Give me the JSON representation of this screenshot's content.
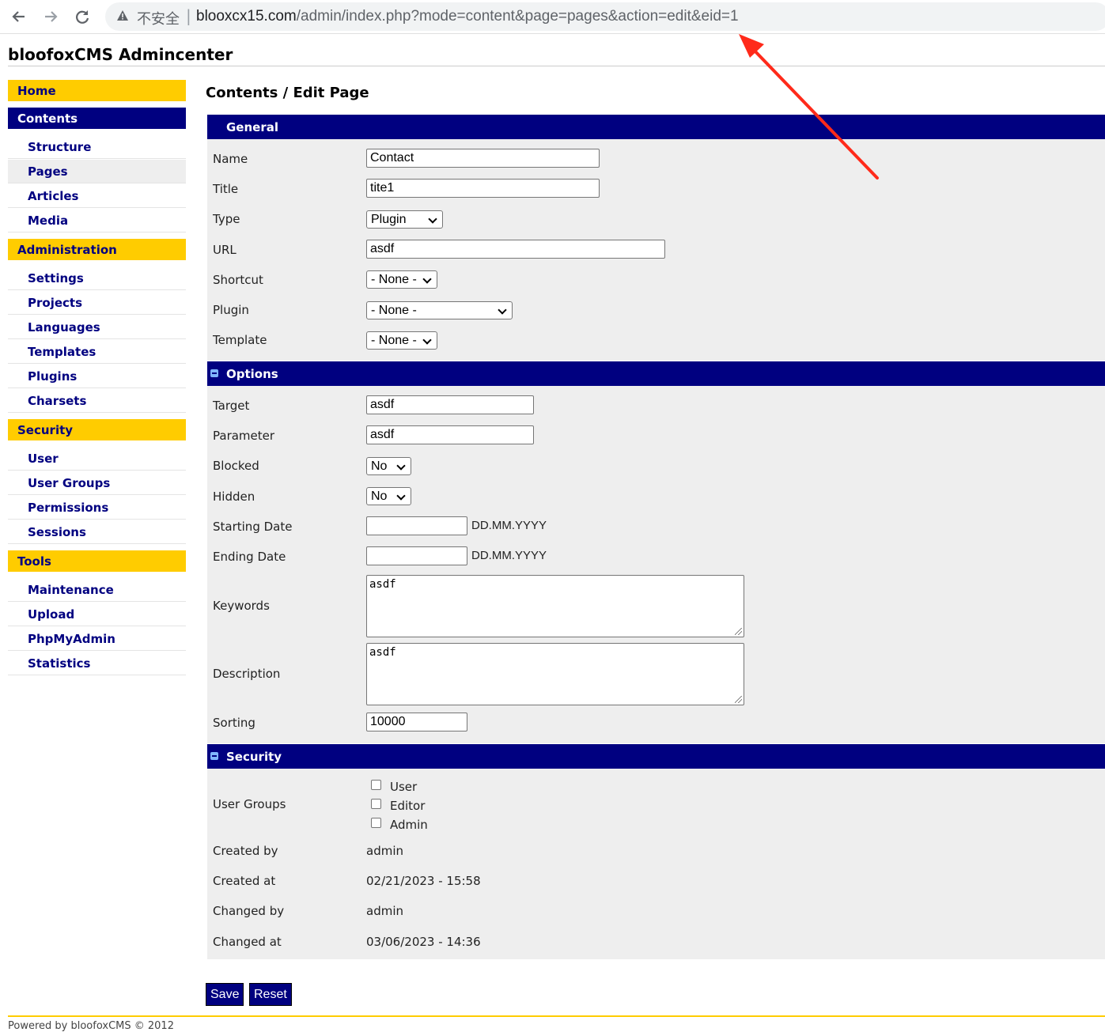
{
  "browser": {
    "back_icon": "back-arrow-icon",
    "forward_icon": "forward-arrow-icon",
    "reload_icon": "reload-icon",
    "security_label": "不安全",
    "separator": "|",
    "url_host": "blooxcx15.com",
    "url_path": "/admin/index.php?mode=content&page=pages&action=edit&eid=1"
  },
  "header": {
    "title": "bloofoxCMS Admincenter"
  },
  "sidebar": {
    "home": "Home",
    "contents": "Contents",
    "contents_items": [
      "Structure",
      "Pages",
      "Articles",
      "Media"
    ],
    "administration": "Administration",
    "administration_items": [
      "Settings",
      "Projects",
      "Languages",
      "Templates",
      "Plugins",
      "Charsets"
    ],
    "security": "Security",
    "security_items": [
      "User",
      "User Groups",
      "Permissions",
      "Sessions"
    ],
    "tools": "Tools",
    "tools_items": [
      "Maintenance",
      "Upload",
      "PhpMyAdmin",
      "Statistics"
    ]
  },
  "main": {
    "heading": "Contents / Edit Page",
    "general": {
      "title": "General",
      "name_label": "Name",
      "name_value": "Contact",
      "title_label": "Title",
      "title_value": "tite1",
      "type_label": "Type",
      "type_value": "Plugin",
      "url_label": "URL",
      "url_value": "asdf",
      "shortcut_label": "Shortcut",
      "shortcut_value": "- None -",
      "plugin_label": "Plugin",
      "plugin_value": "- None -",
      "template_label": "Template",
      "template_value": "- None -"
    },
    "options": {
      "title": "Options",
      "target_label": "Target",
      "target_value": "asdf",
      "parameter_label": "Parameter",
      "parameter_value": "asdf",
      "blocked_label": "Blocked",
      "blocked_value": "No",
      "hidden_label": "Hidden",
      "hidden_value": "No",
      "starting_date_label": "Starting Date",
      "starting_date_value": "",
      "date_hint": "DD.MM.YYYY",
      "ending_date_label": "Ending Date",
      "ending_date_value": "",
      "keywords_label": "Keywords",
      "keywords_value": "asdf",
      "description_label": "Description",
      "description_value": "asdf",
      "sorting_label": "Sorting",
      "sorting_value": "10000"
    },
    "security": {
      "title": "Security",
      "user_groups_label": "User Groups",
      "groups": [
        "User",
        "Editor",
        "Admin"
      ],
      "created_by_label": "Created by",
      "created_by_value": "admin",
      "created_at_label": "Created at",
      "created_at_value": "02/21/2023 - 15:58",
      "changed_by_label": "Changed by",
      "changed_by_value": "admin",
      "changed_at_label": "Changed at",
      "changed_at_value": "03/06/2023 - 14:36"
    },
    "buttons": {
      "save": "Save",
      "reset": "Reset"
    }
  },
  "footer": {
    "text": "Powered by bloofoxCMS © 2012"
  },
  "colors": {
    "nav_blue": "#000080",
    "accent_yellow": "#ffcc00",
    "panel_grey": "#eeeeee",
    "annotation_red": "#ff2a1a"
  }
}
